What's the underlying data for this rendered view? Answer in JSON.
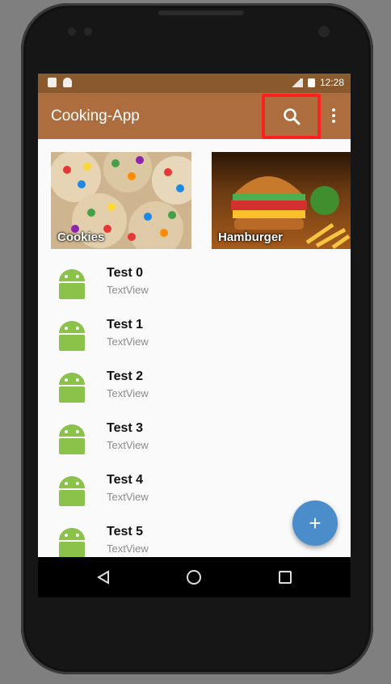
{
  "status_bar": {
    "time": "12:28",
    "left_icons": [
      "sd-card-icon",
      "android-notification-icon"
    ],
    "right_icons": [
      "no-signal-icon",
      "battery-icon"
    ]
  },
  "app_bar": {
    "title": "Cooking-App",
    "actions": [
      "search-icon",
      "overflow-menu-icon"
    ],
    "background": "#ad6d3e",
    "highlight_color": "#ff2020"
  },
  "categories": [
    {
      "label": "Cookies",
      "image": "cookies-image"
    },
    {
      "label": "Hamburger",
      "image": "hamburger-image"
    }
  ],
  "list": {
    "items": [
      {
        "title": "Test 0",
        "subtitle": "TextView"
      },
      {
        "title": "Test 1",
        "subtitle": "TextView"
      },
      {
        "title": "Test 2",
        "subtitle": "TextView"
      },
      {
        "title": "Test 3",
        "subtitle": "TextView"
      },
      {
        "title": "Test 4",
        "subtitle": "TextView"
      },
      {
        "title": "Test 5",
        "subtitle": "TextView"
      }
    ],
    "icon": "android-robot-icon",
    "icon_color": "#8bc34a"
  },
  "fab": {
    "label": "+",
    "color": "#4b8dcb"
  },
  "nav_bar": {
    "buttons": [
      "back-icon",
      "home-icon",
      "recents-icon"
    ]
  }
}
